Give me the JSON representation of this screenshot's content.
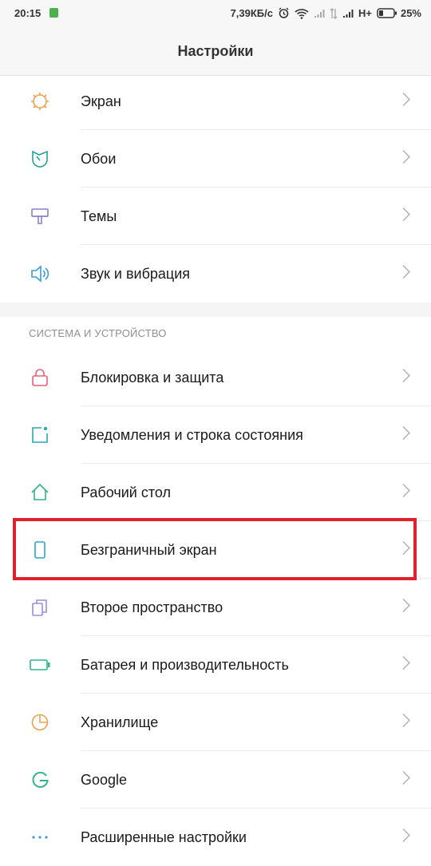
{
  "status": {
    "time": "20:15",
    "speed": "7,39КБ/с",
    "network": "H+",
    "battery": "25%"
  },
  "header": {
    "title": "Настройки"
  },
  "group1": [
    {
      "label": "Экран",
      "icon": "sun-icon",
      "color": "#f0a050"
    },
    {
      "label": "Обои",
      "icon": "wallpaper-icon",
      "color": "#22a39a"
    },
    {
      "label": "Темы",
      "icon": "theme-brush-icon",
      "color": "#8c7fcf"
    },
    {
      "label": "Звук и вибрация",
      "icon": "speaker-icon",
      "color": "#3b9bd6"
    }
  ],
  "section": {
    "title": "СИСТЕМА И УСТРОЙСТВО"
  },
  "group2": [
    {
      "label": "Блокировка и защита",
      "icon": "lock-icon",
      "color": "#e2627a"
    },
    {
      "label": "Уведомления и строка состояния",
      "icon": "notification-icon",
      "color": "#28a7b5"
    },
    {
      "label": "Рабочий стол",
      "icon": "home-icon",
      "color": "#2fb58a"
    },
    {
      "label": "Безграничный экран",
      "icon": "phone-icon",
      "color": "#2aa6c8"
    },
    {
      "label": "Второе пространство",
      "icon": "second-space-icon",
      "color": "#9b8fd8"
    },
    {
      "label": "Батарея и производительность",
      "icon": "battery-icon",
      "color": "#2fb58a"
    },
    {
      "label": "Хранилище",
      "icon": "storage-pie-icon",
      "color": "#f0a050"
    },
    {
      "label": "Google",
      "icon": "google-icon",
      "color": "#2fb58a"
    },
    {
      "label": "Расширенные настройки",
      "icon": "more-dots-icon",
      "color": "#3b9bd6"
    }
  ],
  "colors": {
    "highlight": "#e1202e",
    "chevron": "#b0b0b0"
  }
}
